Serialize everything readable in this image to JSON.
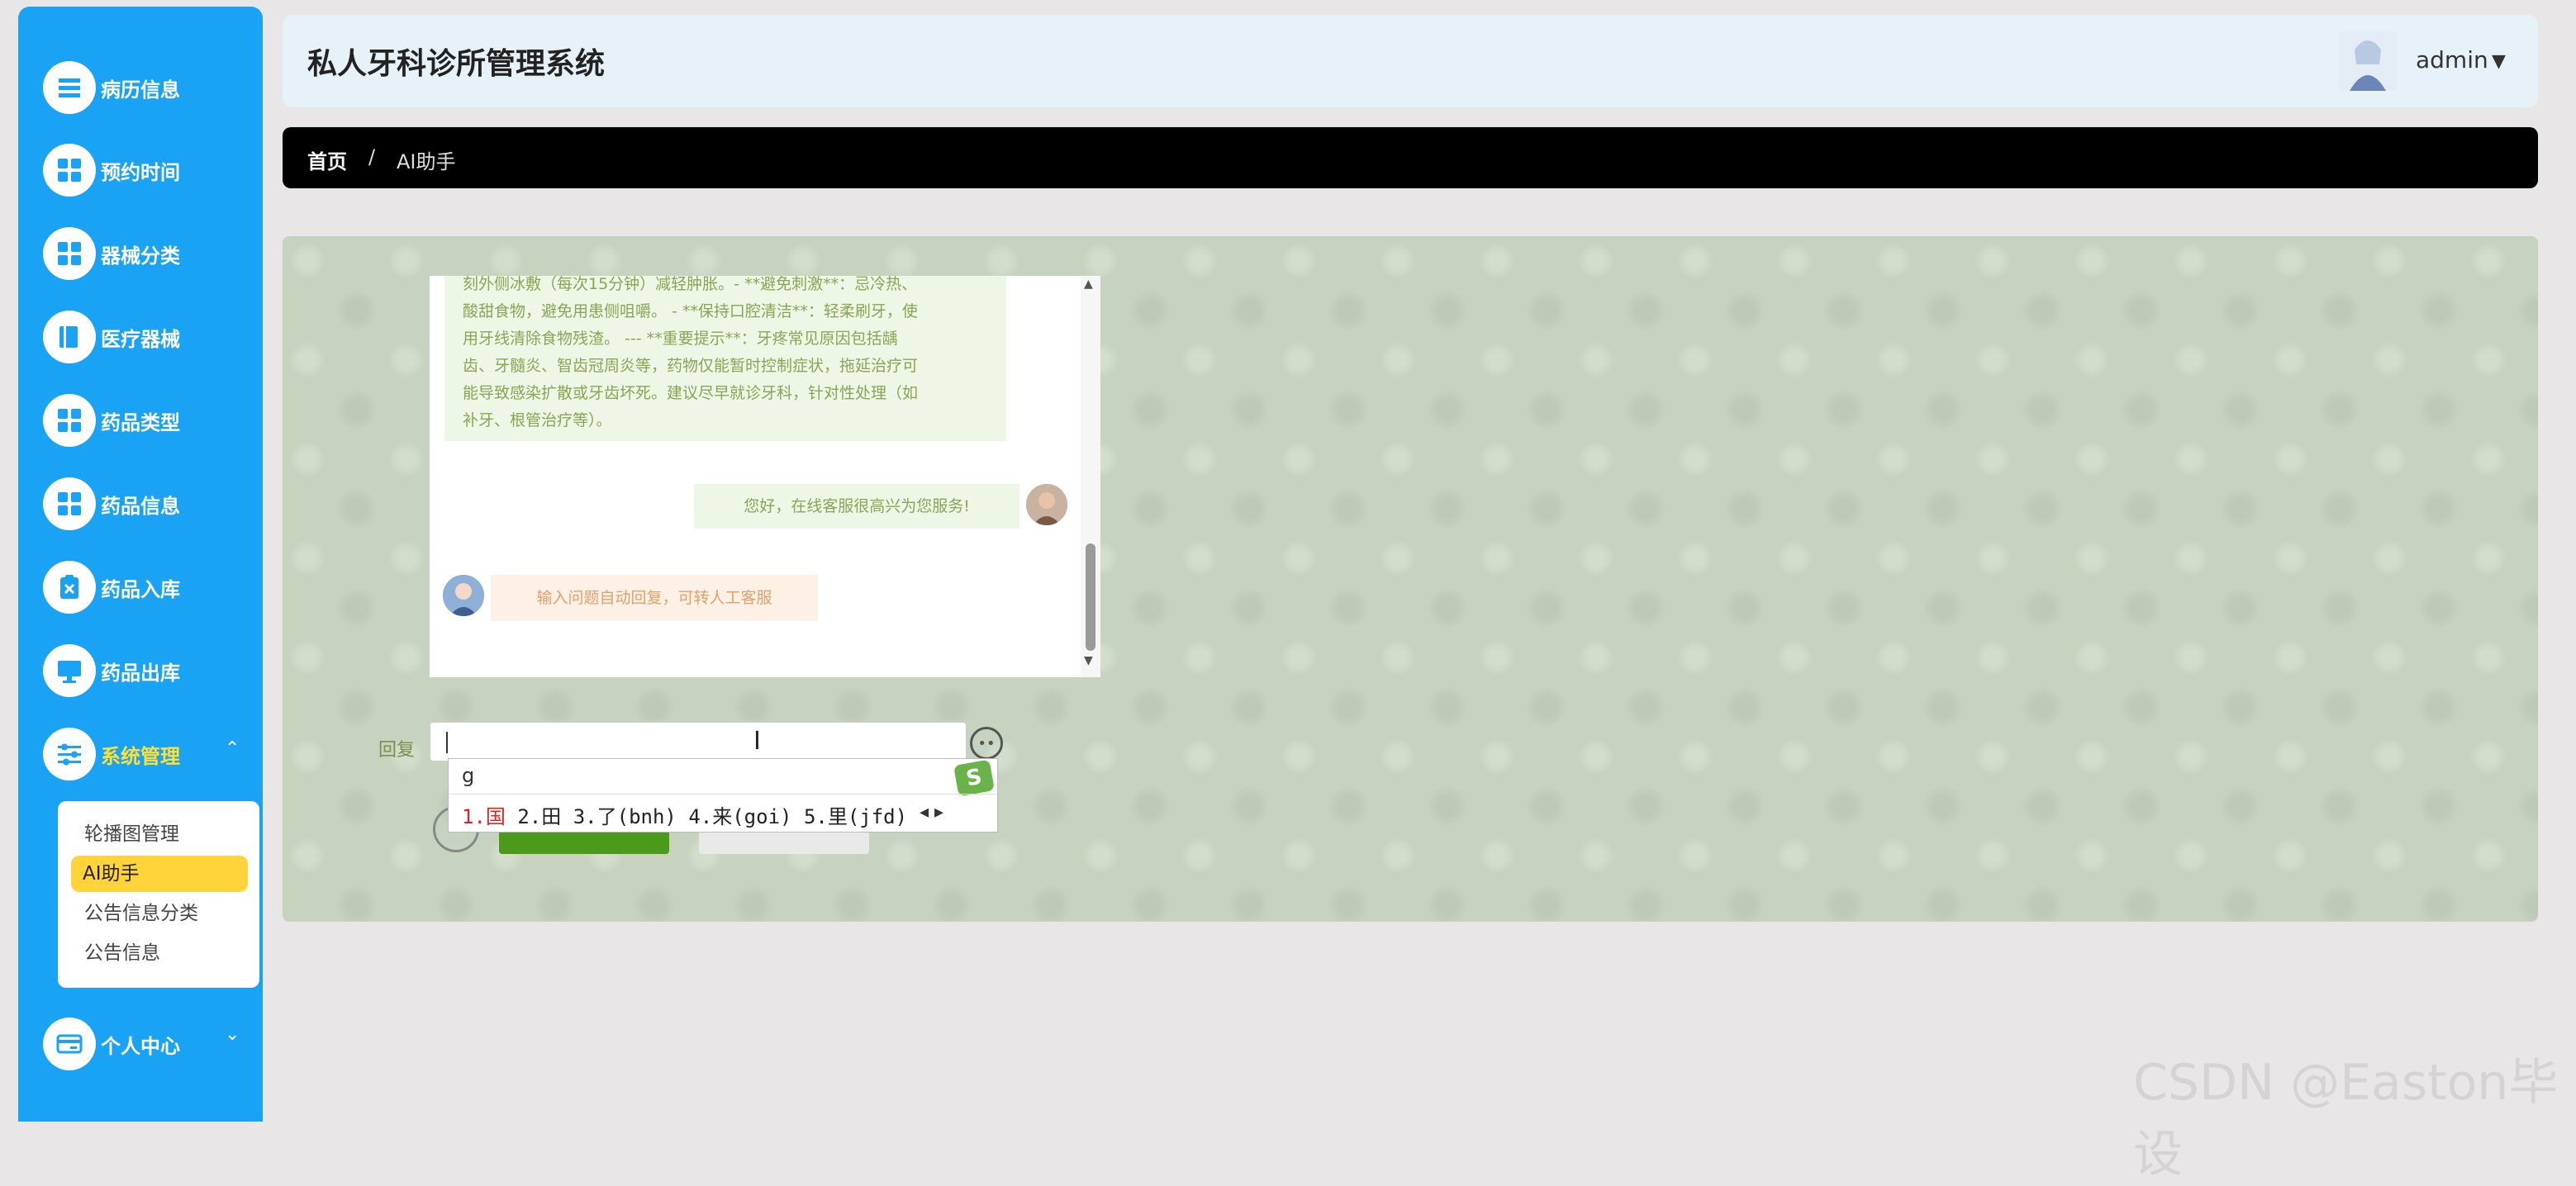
{
  "header": {
    "title": "私人牙科诊所管理系统",
    "user": "admin"
  },
  "breadcrumb": {
    "home": "首页",
    "separator": "/",
    "current": "AI助手"
  },
  "sidebar": {
    "items": [
      {
        "label": "病历信息",
        "icon": "list-icon"
      },
      {
        "label": "预约时间",
        "icon": "grid-icon"
      },
      {
        "label": "器械分类",
        "icon": "grid-icon"
      },
      {
        "label": "医疗器械",
        "icon": "book-icon"
      },
      {
        "label": "药品类型",
        "icon": "grid-icon"
      },
      {
        "label": "药品信息",
        "icon": "grid-icon"
      },
      {
        "label": "药品入库",
        "icon": "clipboard-icon"
      },
      {
        "label": "药品出库",
        "icon": "monitor-icon"
      },
      {
        "label": "系统管理",
        "icon": "sliders-icon"
      },
      {
        "label": "个人中心",
        "icon": "card-icon"
      }
    ],
    "submenu": [
      "轮播图管理",
      "AI助手",
      "公告信息分类",
      "公告信息"
    ]
  },
  "chat": {
    "messages": [
      {
        "from": "ai",
        "lines": [
          "刻外侧冰敷（每次15分钟）减轻肿胀。- **避免刺激**：忌冷热、",
          "酸甜食物，避免用患侧咀嚼。 - **保持口腔清洁**：轻柔刷牙，使",
          "用牙线清除食物残渣。 --- **重要提示**：牙疼常见原因包括龋",
          "齿、牙髓炎、智齿冠周炎等，药物仅能暂时控制症状，拖延治疗可",
          "能导致感染扩散或牙齿坏死。建议尽早就诊牙科，针对性处理（如",
          "补牙、根管治疗等）。"
        ]
      },
      {
        "from": "user",
        "text": "您好，在线客服很高兴为您服务!"
      },
      {
        "from": "ai",
        "text": "输入问题自动回复，可转人工客服"
      }
    ]
  },
  "reply": {
    "label": "回复",
    "value": ""
  },
  "ime": {
    "composition": "g",
    "candidates": [
      "1.国",
      "2.田",
      "3.了(bnh)",
      "4.来(goi)",
      "5.里(jfd)"
    ],
    "logo": "S"
  },
  "watermark": "CSDN @Easton毕设"
}
